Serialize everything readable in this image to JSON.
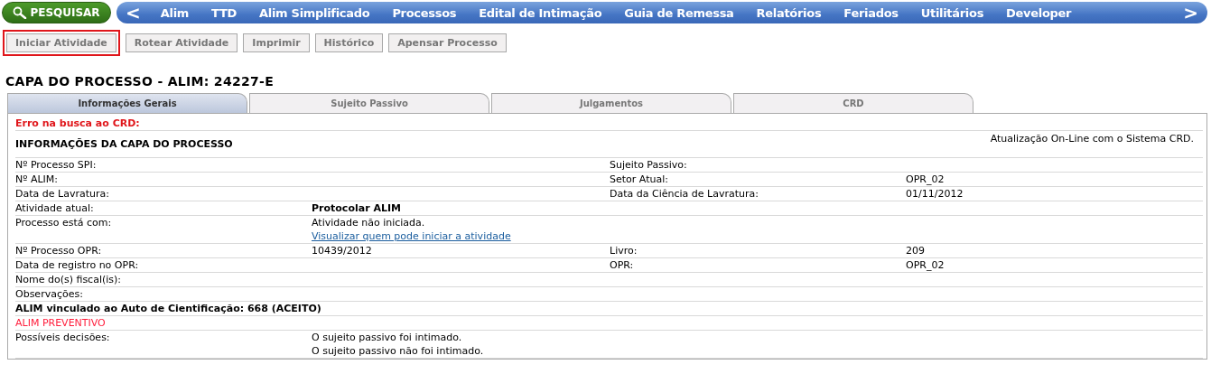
{
  "search_button": {
    "label": "PESQUISAR"
  },
  "menu": {
    "prev": "<",
    "next": ">",
    "items": [
      "Alim",
      "TTD",
      "Alim Simplificado",
      "Processos",
      "Edital de Intimação",
      "Guia de Remessa",
      "Relatórios",
      "Feriados",
      "Utilitários",
      "Developer"
    ]
  },
  "actions": [
    {
      "label": "Iniciar Atividade",
      "highlighted": true
    },
    {
      "label": "Rotear Atividade",
      "highlighted": false
    },
    {
      "label": "Imprimir",
      "highlighted": false
    },
    {
      "label": "Histórico",
      "highlighted": false
    },
    {
      "label": "Apensar Processo",
      "highlighted": false
    }
  ],
  "page_title": "CAPA DO PROCESSO - ALIM: 24227-E",
  "tabs": [
    {
      "label": "Informações Gerais",
      "selected": true
    },
    {
      "label": "Sujeito Passivo",
      "selected": false
    },
    {
      "label": "Julgamentos",
      "selected": false
    },
    {
      "label": "CRD",
      "selected": false
    }
  ],
  "rows": [
    {
      "kind": "error",
      "text": "Erro na busca ao CRD:"
    },
    {
      "kind": "header",
      "text": "INFORMAÇÕES DA CAPA DO PROCESSO",
      "note": "Atualização On-Line com o Sistema CRD."
    },
    {
      "kind": "pair",
      "cells": [
        {
          "label": "Nº Processo SPI:"
        },
        {
          "label": "Sujeito Passivo:"
        }
      ]
    },
    {
      "kind": "pair",
      "cells": [
        {
          "label": "Nº ALIM:"
        },
        {
          "label": "Setor Atual:",
          "value": "OPR_02"
        }
      ]
    },
    {
      "kind": "pair",
      "cells": [
        {
          "label": "Data de Lavratura:"
        },
        {
          "label": "Data da Ciência de Lavratura:",
          "value": "01/11/2012"
        }
      ]
    },
    {
      "kind": "pair",
      "cells": [
        {
          "label": "Atividade atual:",
          "value": "Protocolar ALIM",
          "strong": true
        }
      ]
    },
    {
      "kind": "pair",
      "cells": [
        {
          "label": "Processo está com:",
          "value": "Atividade não iniciada.",
          "link": "Visualizar quem pode iniciar a atividade"
        }
      ]
    },
    {
      "kind": "pair",
      "cells": [
        {
          "label": "Nº Processo OPR:",
          "value": "10439/2012"
        },
        {
          "label": "Livro:",
          "value": "209"
        }
      ]
    },
    {
      "kind": "pair",
      "cells": [
        {
          "label": "Data de registro no OPR:"
        },
        {
          "label": "OPR:",
          "value": "OPR_02"
        }
      ]
    },
    {
      "kind": "pair",
      "cells": [
        {
          "label": "Nome do(s) fiscal(is):"
        }
      ]
    },
    {
      "kind": "pair",
      "cells": [
        {
          "label": "Observações:"
        }
      ]
    },
    {
      "kind": "bold",
      "text": "ALIM vinculado ao Auto de Cientificação: 668 (ACEITO)"
    },
    {
      "kind": "alert",
      "text": "ALIM PREVENTIVO"
    },
    {
      "kind": "pair",
      "cells": [
        {
          "label": "Possíveis decisões:",
          "value": "O sujeito passivo foi intimado.",
          "value2": "O sujeito passivo não foi intimado."
        }
      ]
    }
  ]
}
